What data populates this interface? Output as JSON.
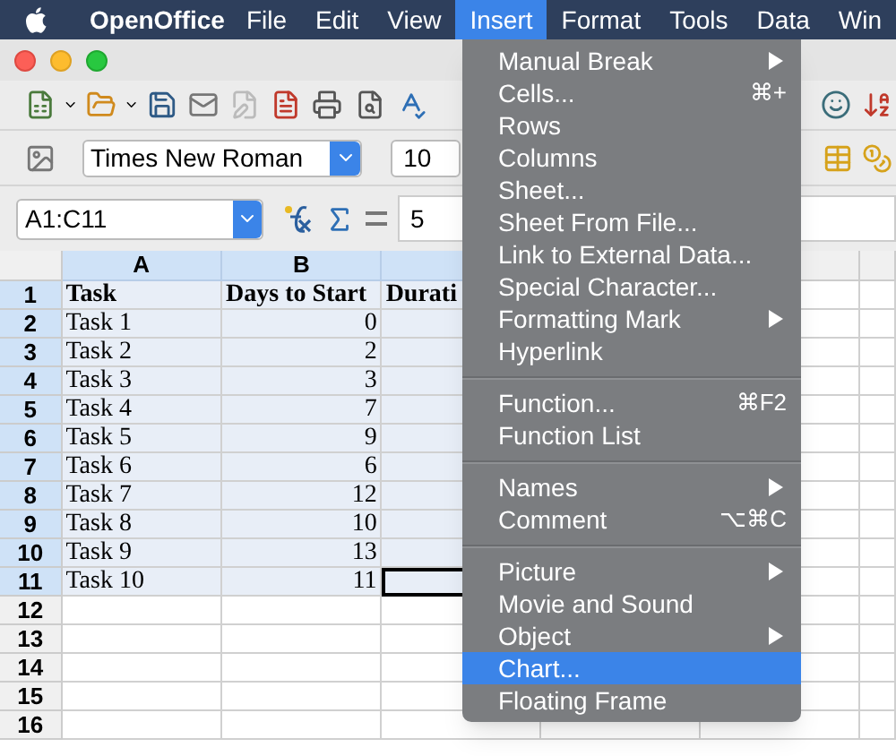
{
  "menubar": {
    "app": "OpenOffice",
    "items": [
      {
        "label": "File",
        "selected": false
      },
      {
        "label": "Edit",
        "selected": false
      },
      {
        "label": "View",
        "selected": false
      },
      {
        "label": "Insert",
        "selected": true
      },
      {
        "label": "Format",
        "selected": false
      },
      {
        "label": "Tools",
        "selected": false
      },
      {
        "label": "Data",
        "selected": false
      },
      {
        "label": "Win",
        "selected": false
      }
    ]
  },
  "format_bar": {
    "font": "Times New Roman",
    "size": "10"
  },
  "formula_bar": {
    "name_box": "A1:C11",
    "value": "5"
  },
  "sheet": {
    "columns": [
      "A",
      "B"
    ],
    "rows": [
      {
        "header": "1",
        "cells": [
          "Task",
          "Days to Start",
          "Durati"
        ]
      },
      {
        "header": "2",
        "cells": [
          "Task 1",
          "0",
          ""
        ]
      },
      {
        "header": "3",
        "cells": [
          "Task 2",
          "2",
          ""
        ]
      },
      {
        "header": "4",
        "cells": [
          "Task 3",
          "3",
          ""
        ]
      },
      {
        "header": "5",
        "cells": [
          "Task 4",
          "7",
          ""
        ]
      },
      {
        "header": "6",
        "cells": [
          "Task 5",
          "9",
          ""
        ]
      },
      {
        "header": "7",
        "cells": [
          "Task 6",
          "6",
          ""
        ]
      },
      {
        "header": "8",
        "cells": [
          "Task 7",
          "12",
          ""
        ]
      },
      {
        "header": "9",
        "cells": [
          "Task 8",
          "10",
          ""
        ]
      },
      {
        "header": "10",
        "cells": [
          "Task 9",
          "13",
          ""
        ]
      },
      {
        "header": "11",
        "cells": [
          "Task 10",
          "11",
          ""
        ]
      },
      {
        "header": "12",
        "cells": [
          "",
          "",
          ""
        ]
      },
      {
        "header": "13",
        "cells": [
          "",
          "",
          ""
        ]
      },
      {
        "header": "14",
        "cells": [
          "",
          "",
          ""
        ]
      },
      {
        "header": "15",
        "cells": [
          "",
          "",
          ""
        ]
      },
      {
        "header": "16",
        "cells": [
          "",
          "",
          ""
        ]
      }
    ]
  },
  "insert_menu": [
    {
      "kind": "item",
      "label": "Manual Break",
      "submenu": true,
      "selected": false
    },
    {
      "kind": "item",
      "label": "Cells...",
      "shortcut": "⌘+",
      "submenu": false,
      "selected": false
    },
    {
      "kind": "item",
      "label": "Rows",
      "submenu": false,
      "selected": false
    },
    {
      "kind": "item",
      "label": "Columns",
      "submenu": false,
      "selected": false
    },
    {
      "kind": "item",
      "label": "Sheet...",
      "submenu": false,
      "selected": false
    },
    {
      "kind": "item",
      "label": "Sheet From File...",
      "submenu": false,
      "selected": false
    },
    {
      "kind": "item",
      "label": "Link to External Data...",
      "submenu": false,
      "selected": false
    },
    {
      "kind": "item",
      "label": "Special Character...",
      "submenu": false,
      "selected": false
    },
    {
      "kind": "item",
      "label": "Formatting Mark",
      "submenu": true,
      "selected": false
    },
    {
      "kind": "item",
      "label": "Hyperlink",
      "submenu": false,
      "selected": false
    },
    {
      "kind": "separator"
    },
    {
      "kind": "item",
      "label": "Function...",
      "shortcut": "⌘F2",
      "submenu": false,
      "selected": false
    },
    {
      "kind": "item",
      "label": "Function List",
      "submenu": false,
      "selected": false
    },
    {
      "kind": "separator"
    },
    {
      "kind": "item",
      "label": "Names",
      "submenu": true,
      "selected": false
    },
    {
      "kind": "item",
      "label": "Comment",
      "shortcut": "⌥⌘C",
      "submenu": false,
      "selected": false
    },
    {
      "kind": "separator"
    },
    {
      "kind": "item",
      "label": "Picture",
      "submenu": true,
      "selected": false
    },
    {
      "kind": "item",
      "label": "Movie and Sound",
      "submenu": false,
      "selected": false
    },
    {
      "kind": "item",
      "label": "Object",
      "submenu": true,
      "selected": false
    },
    {
      "kind": "item",
      "label": "Chart...",
      "submenu": false,
      "selected": true
    },
    {
      "kind": "item",
      "label": "Floating Frame",
      "submenu": false,
      "selected": false
    }
  ]
}
